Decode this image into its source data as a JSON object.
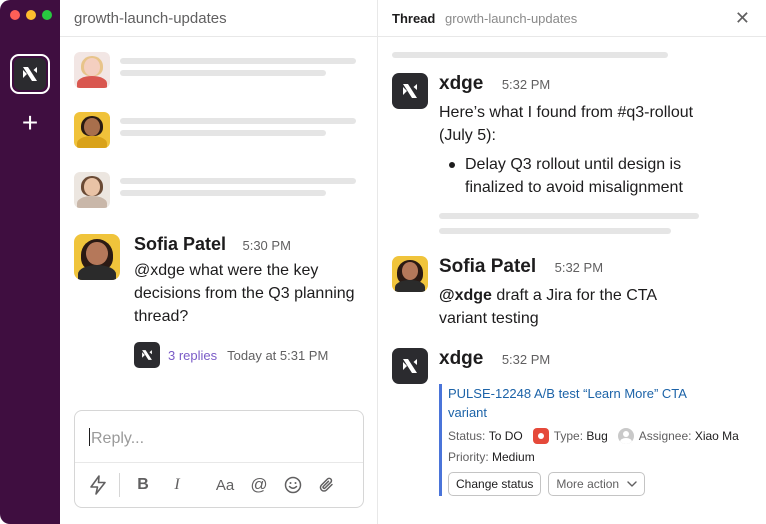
{
  "window": {
    "controls": [
      "close",
      "minimize",
      "maximize"
    ]
  },
  "rail": {
    "workspace_icon": "xdge-logo-icon",
    "add_icon": "plus-icon",
    "add_label": "+"
  },
  "channel": {
    "name": "growth-launch-updates",
    "message": {
      "author": "Sofia Patel",
      "time": "5:30 PM",
      "text": "@xdge what were the key decisions from the Q3 planning thread?",
      "replies_label": "3 replies",
      "replies_time": "Today at 5:31 PM"
    },
    "composer": {
      "placeholder": "Reply...",
      "tools": {
        "shortcuts": "lightning-icon",
        "bold": "B",
        "italic": "I",
        "text_format": "Aa",
        "mention": "@",
        "emoji": "smiley-icon",
        "attach": "paperclip-icon"
      }
    }
  },
  "thread": {
    "title": "Thread",
    "channel": "growth-launch-updates",
    "close_label": "✕",
    "messages": [
      {
        "author": "xdge",
        "time": "5:32 PM",
        "text": "Here’s what I found from #q3-rollout (July 5):",
        "bullet": "Delay Q3 rollout until design is finalized to avoid misalignment"
      },
      {
        "author": "Sofia Patel",
        "time": "5:32 PM",
        "mention": "@xdge",
        "text": " draft a Jira for the CTA variant testing"
      },
      {
        "author": "xdge",
        "time": "5:32 PM"
      }
    ],
    "jira": {
      "title": "PULSE-12248 A/B test “Learn More” CTA variant",
      "status_label": "Status:",
      "status_value": "To DO",
      "type_label": "Type:",
      "type_value": "Bug",
      "assignee_label": "Assignee:",
      "assignee_value": "Xiao Ma",
      "priority_label": "Priority:",
      "priority_value": "Medium",
      "change_status_label": "Change status",
      "more_action_label": "More action"
    }
  },
  "colors": {
    "rail": "#3f0e40",
    "accent_link": "#7a5bc7",
    "jira_link": "#1c63a8",
    "jira_bar": "#4a74d9",
    "bug": "#e5493a"
  }
}
